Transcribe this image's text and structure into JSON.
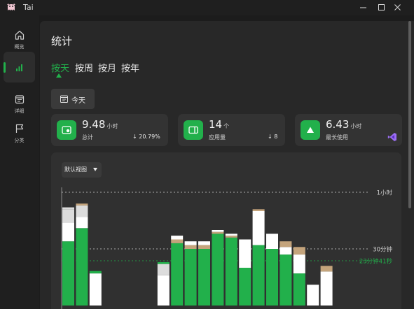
{
  "window": {
    "title": "Tai"
  },
  "sidebar": {
    "items": [
      {
        "label": "概览",
        "icon": "home-icon"
      },
      {
        "label": "",
        "icon": "bar-chart-icon"
      },
      {
        "label": "详细",
        "icon": "calendar-icon"
      },
      {
        "label": "分类",
        "icon": "flag-icon"
      }
    ]
  },
  "page": {
    "title": "统计"
  },
  "tabs": [
    "按天",
    "按周",
    "按月",
    "按年"
  ],
  "date_button": {
    "label": "今天"
  },
  "cards": [
    {
      "value": "9.48",
      "unit": "小时",
      "label": "总计",
      "delta": "20.79%",
      "icon": "timer-icon"
    },
    {
      "value": "14",
      "unit": "个",
      "label": "应用量",
      "delta": "8",
      "icon": "window-icon"
    },
    {
      "value": "6.43",
      "unit": "小时",
      "label": "最长使用",
      "icon": "triangle-icon",
      "app_icon": "visual-studio-icon"
    }
  ],
  "chart_controls": {
    "view_label": "默认视图"
  },
  "colors": {
    "accent": "#22b04b",
    "tan": "#c4a47c",
    "white": "#ffffff",
    "gray": "#dcdcdc"
  },
  "chart_data": {
    "type": "bar",
    "stacked": true,
    "unit": "minutes",
    "reference_lines": [
      {
        "label": "1小时",
        "value": 60
      },
      {
        "label": "30分钟",
        "value": 30
      },
      {
        "label": "23分钟41秒",
        "value": 23.7
      }
    ],
    "bars": [
      [
        {
          "c": "green",
          "v": 34
        },
        {
          "c": "white",
          "v": 10
        },
        {
          "c": "gray",
          "v": 7
        },
        {
          "c": "gray",
          "v": 1
        }
      ],
      [
        {
          "c": "green",
          "v": 41
        },
        {
          "c": "white",
          "v": 6
        },
        {
          "c": "gray",
          "v": 6
        },
        {
          "c": "tan",
          "v": 1
        }
      ],
      [
        {
          "c": "white",
          "v": 17
        },
        {
          "c": "green",
          "v": 1.3
        }
      ],
      [],
      [],
      [],
      [],
      [
        {
          "c": "white",
          "v": 16
        },
        {
          "c": "gray",
          "v": 6
        },
        {
          "c": "green",
          "v": 1
        }
      ],
      [
        {
          "c": "green",
          "v": 33
        },
        {
          "c": "tan",
          "v": 2
        },
        {
          "c": "white",
          "v": 2
        }
      ],
      [
        {
          "c": "green",
          "v": 30
        },
        {
          "c": "tan",
          "v": 2
        },
        {
          "c": "white",
          "v": 2
        }
      ],
      [
        {
          "c": "green",
          "v": 30
        },
        {
          "c": "tan",
          "v": 2
        },
        {
          "c": "white",
          "v": 2
        }
      ],
      [
        {
          "c": "green",
          "v": 38
        },
        {
          "c": "tan",
          "v": 1
        },
        {
          "c": "white",
          "v": 1
        }
      ],
      [
        {
          "c": "green",
          "v": 36
        },
        {
          "c": "tan",
          "v": 1
        },
        {
          "c": "white",
          "v": 1
        }
      ],
      [
        {
          "c": "green",
          "v": 20
        },
        {
          "c": "white",
          "v": 15
        }
      ],
      [
        {
          "c": "green",
          "v": 32
        },
        {
          "c": "white",
          "v": 18
        },
        {
          "c": "tan",
          "v": 1
        }
      ],
      [
        {
          "c": "green",
          "v": 30
        },
        {
          "c": "white",
          "v": 8
        }
      ],
      [
        {
          "c": "green",
          "v": 27
        },
        {
          "c": "white",
          "v": 4
        },
        {
          "c": "tan",
          "v": 3
        }
      ],
      [
        {
          "c": "green",
          "v": 17
        },
        {
          "c": "white",
          "v": 10
        },
        {
          "c": "tan",
          "v": 4
        }
      ],
      [
        {
          "c": "white",
          "v": 11
        }
      ],
      [
        {
          "c": "white",
          "v": 18
        },
        {
          "c": "tan",
          "v": 3
        }
      ]
    ]
  }
}
